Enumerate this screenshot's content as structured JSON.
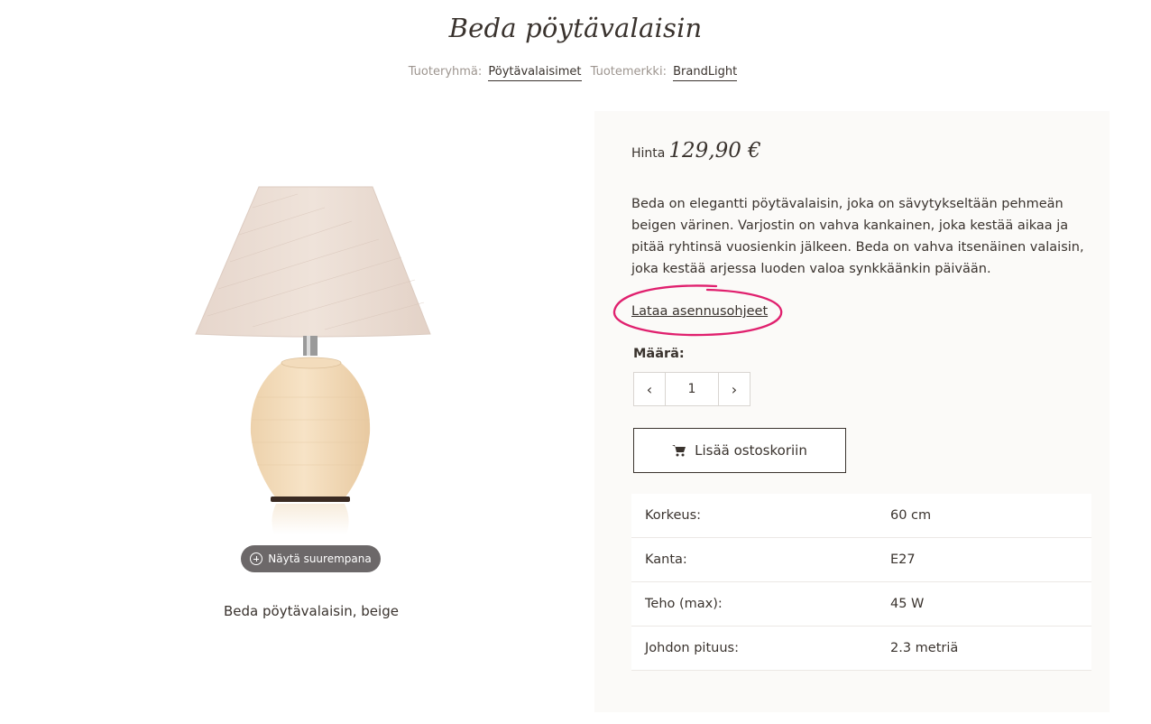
{
  "product": {
    "title": "Beda pöytävalaisin",
    "category_label": "Tuoteryhmä:",
    "category": "Pöytävalaisimet",
    "brand_label": "Tuotemerkki:",
    "brand": "BrandLight",
    "zoom_label": "Näytä suurempana",
    "image_caption": "Beda pöytävalaisin, beige"
  },
  "purchase": {
    "price_label": "Hinta",
    "price": "129,90 €",
    "description": "Beda on elegantti pöytävalaisin, joka on sävytykseltään pehmeän beigen värinen. Varjostin on vahva kankainen, joka kestää aikaa ja pitää ryhtinsä vuosienkin jälkeen. Beda on vahva itsenäinen valaisin, joka kestää arjessa luoden valoa synkkäänkin päivään.",
    "download_link": "Lataa asennusohjeet",
    "quantity_label": "Määrä:",
    "quantity": "1",
    "decrement": "‹",
    "increment": "›",
    "add_to_cart": "Lisää ostoskoriin"
  },
  "specs": [
    {
      "key": "Korkeus:",
      "value": "60 cm"
    },
    {
      "key": "Kanta:",
      "value": "E27"
    },
    {
      "key": "Teho (max):",
      "value": "45 W"
    },
    {
      "key": "Johdon pituus:",
      "value": "2.3 metriä"
    }
  ],
  "colors": {
    "highlight": "#e0206e",
    "text": "#3a332e",
    "panel_bg": "#fbfaf8",
    "zoom_button": "#6c6869"
  }
}
